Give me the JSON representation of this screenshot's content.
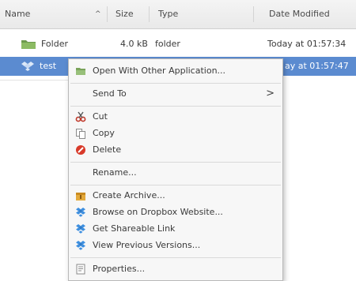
{
  "columns": {
    "name": "Name",
    "size": "Size",
    "type": "Type",
    "modified": "Date Modified",
    "sort_indicator": "^"
  },
  "rows": [
    {
      "name": "Folder",
      "size": "4.0 kB",
      "type": "folder",
      "modified": "Today at 01:57:34",
      "icon": "folder-icon"
    },
    {
      "name": "test",
      "modified": "ay at 01:57:47",
      "icon": "dropbox-file-icon",
      "selected": true
    }
  ],
  "context_menu": {
    "items": [
      {
        "label": "Open With Other Application...",
        "icon": "open-with-icon"
      },
      {
        "label": "Send To",
        "submenu_indicator": ">"
      },
      {
        "label": "Cut",
        "icon": "scissors-icon"
      },
      {
        "label": "Copy",
        "icon": "copy-icon"
      },
      {
        "label": "Delete",
        "icon": "delete-icon"
      },
      {
        "label": "Rename..."
      },
      {
        "label": "Create Archive...",
        "icon": "archive-icon"
      },
      {
        "label": "Browse on Dropbox Website...",
        "icon": "dropbox-icon"
      },
      {
        "label": "Get Shareable Link",
        "icon": "dropbox-icon"
      },
      {
        "label": "View Previous Versions...",
        "icon": "dropbox-icon"
      },
      {
        "label": "Properties...",
        "icon": "properties-icon"
      }
    ]
  },
  "colors": {
    "selection": "#5b8bd0",
    "folder": "#7aa35a",
    "delete": "#d83a2a",
    "dropbox": "#3d8fe0"
  }
}
